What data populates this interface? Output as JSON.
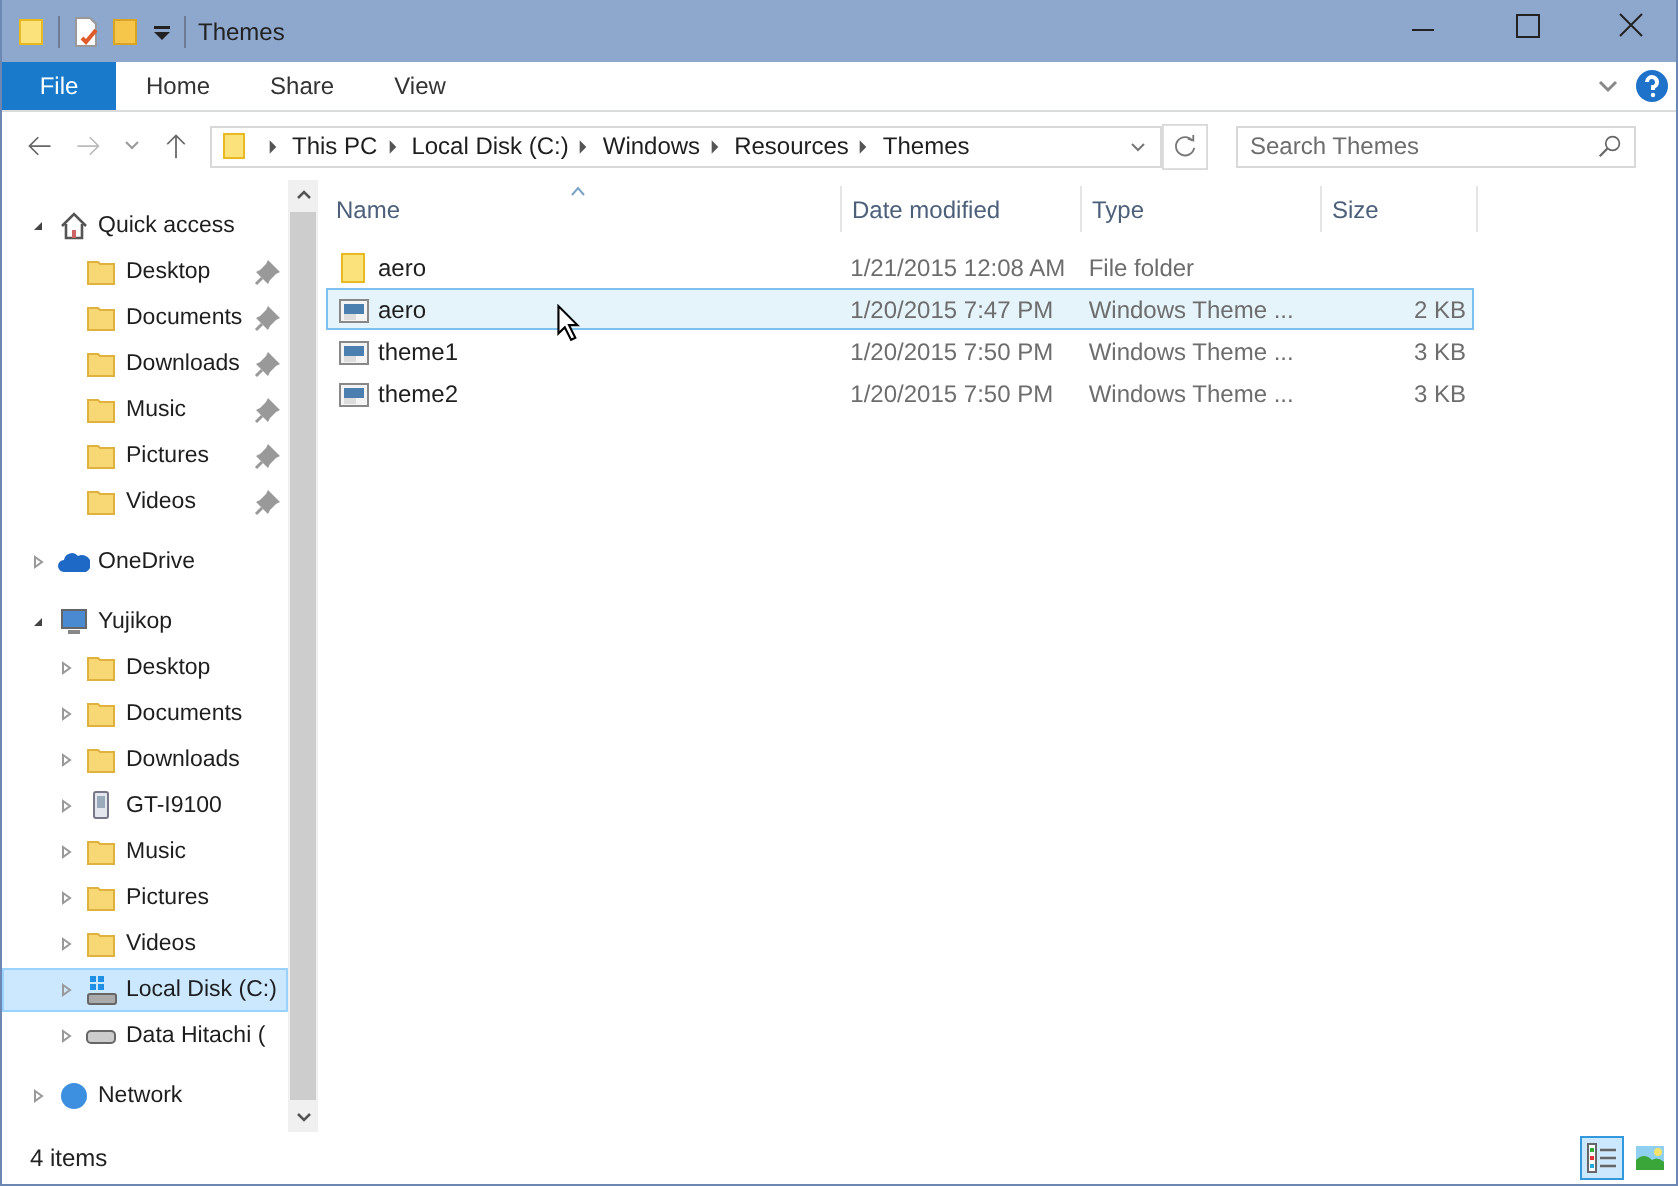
{
  "window": {
    "title": "Themes"
  },
  "ribbon_tabs": [
    {
      "label": "File",
      "kind": "file"
    },
    {
      "label": "Home",
      "kind": "tab"
    },
    {
      "label": "Share",
      "kind": "tab"
    },
    {
      "label": "View",
      "kind": "tab"
    }
  ],
  "address_bar": {
    "breadcrumbs": [
      "This PC",
      "Local Disk (C:)",
      "Windows",
      "Resources",
      "Themes"
    ]
  },
  "search": {
    "placeholder": "Search Themes"
  },
  "navigation": [
    {
      "label": "Quick access",
      "kind": "home",
      "expanded": true,
      "selected": false,
      "children": [
        {
          "label": "Desktop",
          "kind": "folder",
          "pinned": true,
          "selected": false
        },
        {
          "label": "Documents",
          "kind": "folder",
          "pinned": true,
          "selected": false
        },
        {
          "label": "Downloads",
          "kind": "folder",
          "pinned": true,
          "selected": false
        },
        {
          "label": "Music",
          "kind": "folder",
          "pinned": true,
          "selected": false
        },
        {
          "label": "Pictures",
          "kind": "folder",
          "pinned": true,
          "selected": false
        },
        {
          "label": "Videos",
          "kind": "folder",
          "pinned": true,
          "selected": false
        }
      ]
    },
    {
      "label": "OneDrive",
      "kind": "cloud",
      "expanded": false,
      "selected": false
    },
    {
      "label": "Yujikop",
      "kind": "computer",
      "expanded": true,
      "selected": false,
      "children": [
        {
          "label": "Desktop",
          "kind": "folder",
          "expanded": false,
          "selected": false
        },
        {
          "label": "Documents",
          "kind": "folder",
          "expanded": false,
          "selected": false
        },
        {
          "label": "Downloads",
          "kind": "folder",
          "expanded": false,
          "selected": false
        },
        {
          "label": "GT-I9100",
          "kind": "device",
          "expanded": false,
          "selected": false
        },
        {
          "label": "Music",
          "kind": "folder",
          "expanded": false,
          "selected": false
        },
        {
          "label": "Pictures",
          "kind": "folder",
          "expanded": false,
          "selected": false
        },
        {
          "label": "Videos",
          "kind": "folder",
          "expanded": false,
          "selected": false
        },
        {
          "label": "Local Disk (C:)",
          "kind": "system-drive",
          "expanded": false,
          "selected": true
        },
        {
          "label": "Data Hitachi (",
          "kind": "drive",
          "expanded": false,
          "selected": false
        }
      ]
    },
    {
      "label": "Network",
      "kind": "network",
      "expanded": false,
      "selected": false
    }
  ],
  "table": {
    "columns": [
      "Name",
      "Date modified",
      "Type",
      "Size"
    ],
    "rows": [
      {
        "name": "aero",
        "kind": "folder",
        "date": "1/21/2015 12:08 AM",
        "type": "File folder",
        "size": "",
        "selected": false
      },
      {
        "name": "aero",
        "kind": "theme",
        "date": "1/20/2015 7:47 PM",
        "type": "Windows Theme ...",
        "size": "2 KB",
        "selected": true
      },
      {
        "name": "theme1",
        "kind": "theme",
        "date": "1/20/2015 7:50 PM",
        "type": "Windows Theme ...",
        "size": "3 KB",
        "selected": false
      },
      {
        "name": "theme2",
        "kind": "theme",
        "date": "1/20/2015 7:50 PM",
        "type": "Windows Theme ...",
        "size": "3 KB",
        "selected": false
      }
    ]
  },
  "status_bar": {
    "item_count": "4 items"
  },
  "view_buttons": [
    {
      "kind": "details",
      "selected": true
    },
    {
      "kind": "tiles",
      "selected": false
    }
  ]
}
